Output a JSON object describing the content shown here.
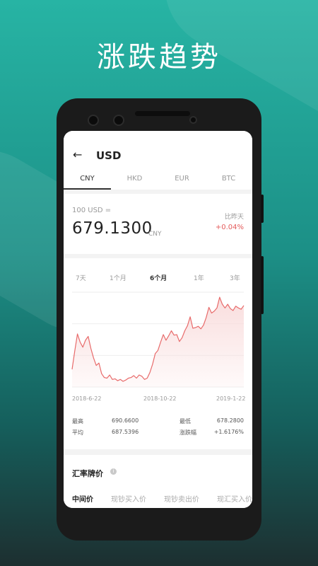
{
  "headline": "涨跌趋势",
  "header": {
    "title": "USD"
  },
  "currency_tabs": [
    "CNY",
    "HKD",
    "EUR",
    "BTC"
  ],
  "rate": {
    "base_label": "100 USD =",
    "value": "679.1300",
    "unit": "CNY",
    "compare_label": "比昨天",
    "change": "+0.04%"
  },
  "ranges": [
    "7天",
    "1个月",
    "6个月",
    "1年",
    "3年"
  ],
  "chart_data": {
    "type": "area",
    "x_labels": [
      "2018-6-22",
      "2018-10-22",
      "2019-1-22"
    ],
    "values": [
      680.3,
      683.2,
      685.9,
      684.6,
      683.8,
      684.9,
      685.5,
      683.6,
      682.1,
      680.9,
      681.3,
      679.6,
      679.0,
      678.9,
      679.4,
      678.7,
      678.8,
      678.5,
      678.7,
      678.4,
      678.6,
      678.9,
      679.0,
      679.3,
      678.9,
      679.4,
      679.2,
      678.7,
      678.9,
      679.8,
      681.1,
      682.8,
      683.3,
      684.6,
      685.8,
      684.9,
      685.6,
      686.4,
      685.7,
      685.8,
      684.7,
      685.3,
      686.4,
      687.2,
      688.6,
      686.8,
      686.9,
      687.1,
      686.7,
      687.3,
      688.5,
      690.1,
      689.2,
      689.5,
      690.0,
      691.7,
      690.6,
      690.0,
      690.6,
      689.9,
      689.6,
      690.3,
      690.0,
      689.8,
      690.4
    ],
    "grid": true,
    "ylim": [
      677.5,
      692.5
    ],
    "colors": {
      "line": "#e86b6b",
      "fill": "#f9dcdc"
    }
  },
  "stats": [
    {
      "label": "最高",
      "value": "690.6600"
    },
    {
      "label": "最低",
      "value": "678.2800"
    },
    {
      "label": "平均",
      "value": "687.5396"
    },
    {
      "label": "涨跌幅",
      "value": "+1.6176%"
    }
  ],
  "rates_section": {
    "title": "汇率牌价",
    "columns": [
      "中间价",
      "现钞买入价",
      "现钞卖出价",
      "现汇买入价"
    ]
  }
}
